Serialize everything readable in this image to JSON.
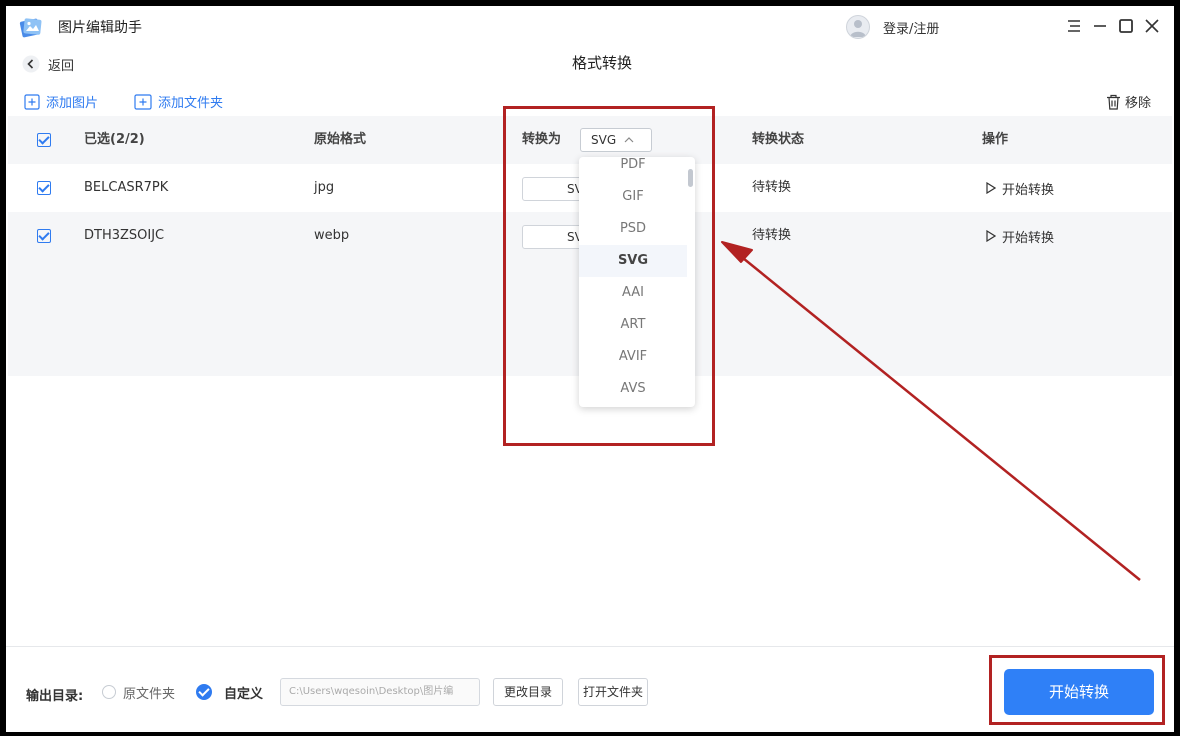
{
  "app": {
    "title": "图片编辑助手",
    "login": "登录/注册"
  },
  "header": {
    "back_label": "返回",
    "page_title": "格式转换"
  },
  "toolbar": {
    "add_image": "添加图片",
    "add_folder": "添加文件夹",
    "remove": "移除"
  },
  "table": {
    "columns": {
      "selected": "已选(2/2)",
      "original_format": "原始格式",
      "convert_to": "转换为",
      "status": "转换状态",
      "action": "操作"
    },
    "convert_to_value": "SVG",
    "rows": [
      {
        "name": "BELCASR7PK",
        "format": "jpg",
        "target": "SV",
        "status": "待转换",
        "action": "开始转换"
      },
      {
        "name": "DTH3ZSOIJC",
        "format": "webp",
        "target": "SV",
        "status": "待转换",
        "action": "开始转换"
      }
    ]
  },
  "dropdown": {
    "options": [
      "PDF",
      "GIF",
      "PSD",
      "SVG",
      "AAI",
      "ART",
      "AVIF",
      "AVS"
    ],
    "selected_index": 3
  },
  "footer": {
    "output_label": "输出目录:",
    "option_original": "原文件夹",
    "option_custom": "自定义",
    "path": "C:\\Users\\wqesoin\\Desktop\\图片编",
    "change_dir": "更改目录",
    "open_folder": "打开文件夹",
    "start": "开始转换"
  },
  "colors": {
    "accent": "#2f80f7",
    "annotation": "#b22222"
  }
}
